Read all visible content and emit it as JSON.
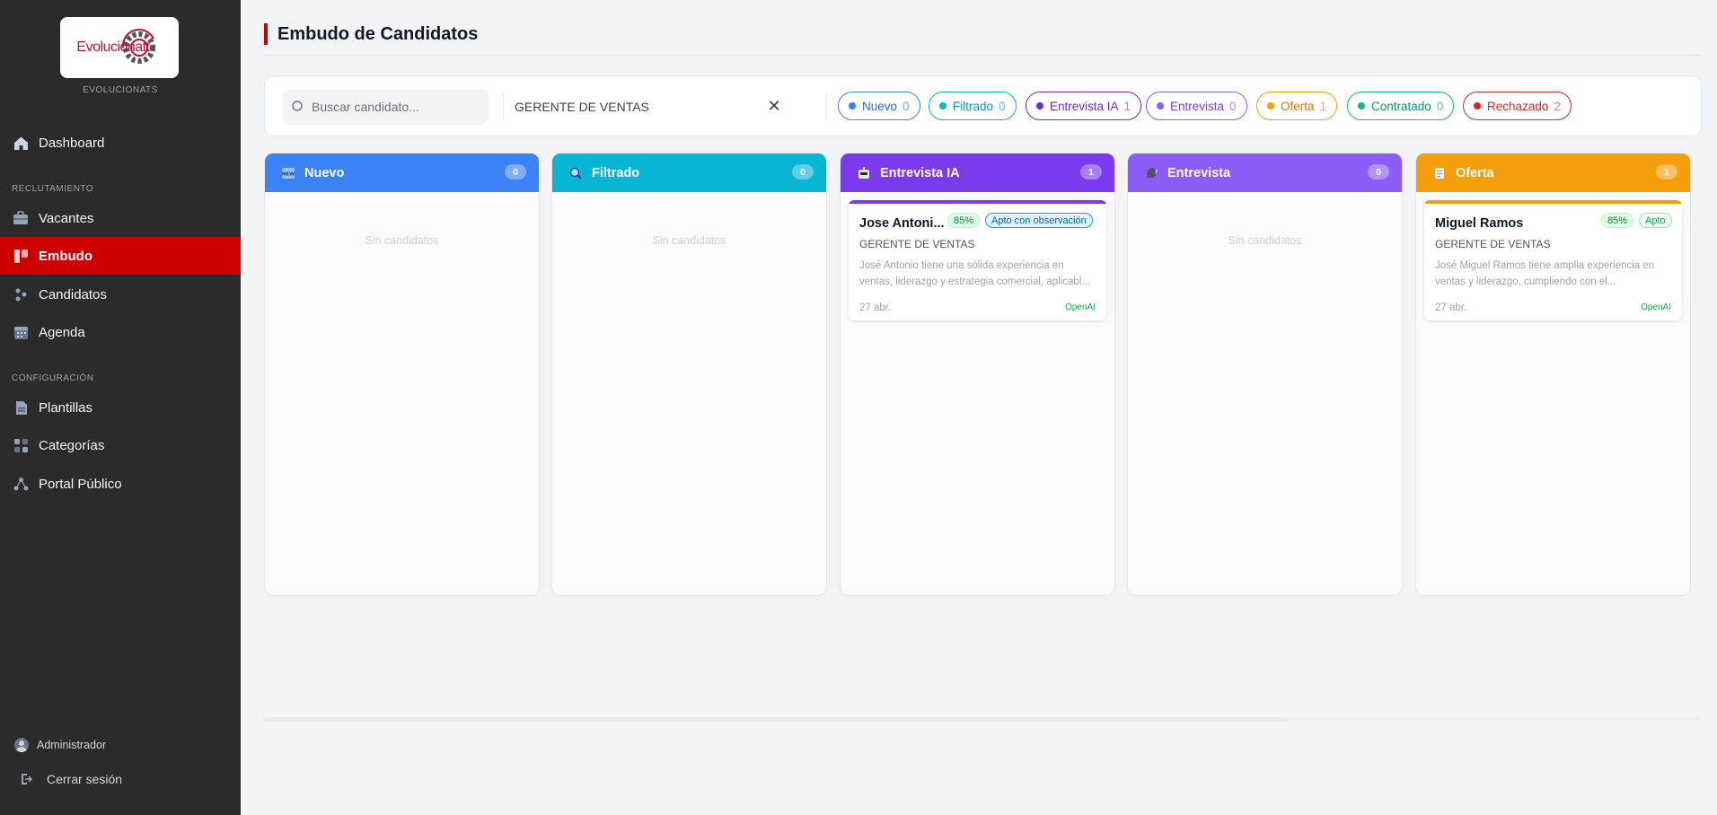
{
  "sidebar": {
    "brand_sub": "EVOLUCIONATS",
    "logo_text": "Evolucionatt",
    "items": [
      {
        "label": "Dashboard",
        "icon": "home-icon"
      },
      {
        "label": "Vacantes",
        "icon": "briefcase-icon"
      },
      {
        "label": "Embudo",
        "icon": "kanban-icon",
        "active": true
      },
      {
        "label": "Candidatos",
        "icon": "people-icon"
      },
      {
        "label": "Agenda",
        "icon": "calendar-icon"
      },
      {
        "label": "Plantillas",
        "icon": "template-icon"
      },
      {
        "label": "Categorías",
        "icon": "grid-icon"
      },
      {
        "label": "Portal Público",
        "icon": "share-icon"
      }
    ],
    "section_recruit": "RECLUTAMIENTO",
    "section_config": "CONFIGURACIÓN",
    "user_name": "Administrador",
    "logout_label": "Cerrar sesión"
  },
  "page": {
    "title": "Embudo de Candidatos"
  },
  "filters": {
    "search_placeholder": "Buscar candidato...",
    "vacancy_value": "GERENTE DE VENTAS",
    "clear_symbol": "✕",
    "chips": [
      {
        "label": "Nuevo",
        "count": "0",
        "color": "#3b82f6"
      },
      {
        "label": "Filtrado",
        "count": "0",
        "color": "#06b6d4"
      },
      {
        "label": "Entrevista IA",
        "count": "1",
        "color": "#6d28d9"
      },
      {
        "label": "Entrevista",
        "count": "0",
        "color": "#8b5cf6"
      },
      {
        "label": "Oferta",
        "count": "1",
        "color": "#f59e0b"
      },
      {
        "label": "Contratado",
        "count": "0",
        "color": "#10b981"
      },
      {
        "label": "Rechazado",
        "count": "2",
        "color": "#dc2626"
      }
    ]
  },
  "columns": [
    {
      "title": "Nuevo",
      "count": "0",
      "color": "#3b82f6",
      "icon": "new-badge-icon",
      "empty_text": "Sin candidatos"
    },
    {
      "title": "Filtrado",
      "count": "0",
      "color": "#06b6d4",
      "icon": "magnifier-icon",
      "empty_text": "Sin candidatos"
    },
    {
      "title": "Entrevista IA",
      "count": "1",
      "color": "#7c3aed",
      "icon": "robot-icon"
    },
    {
      "title": "Entrevista",
      "count": "0",
      "color": "#8b5cf6",
      "icon": "speaking-head-icon",
      "empty_text": "Sin candidatos"
    },
    {
      "title": "Oferta",
      "count": "1",
      "color": "#f59e0b",
      "icon": "document-icon"
    }
  ],
  "cards": {
    "entrevista_ia": {
      "name": "Jose Antoni...",
      "score": "85%",
      "status": "Apto con observación",
      "role": "GERENTE DE VENTAS",
      "desc": "José Antonio tiene una sólida experiencia en ventas, liderazgo y estrategia comercial, aplicabl...",
      "date": "27 abr.",
      "source": "OpenAI"
    },
    "oferta": {
      "name": "Miguel Ramos",
      "score": "85%",
      "status": "Apto",
      "role": "GERENTE DE VENTAS",
      "desc": "José Miguel Ramos tiene amplia experiencia en ventas y liderazgo, cumpliendo con el...",
      "date": "27 abr.",
      "source": "OpenAI"
    }
  }
}
